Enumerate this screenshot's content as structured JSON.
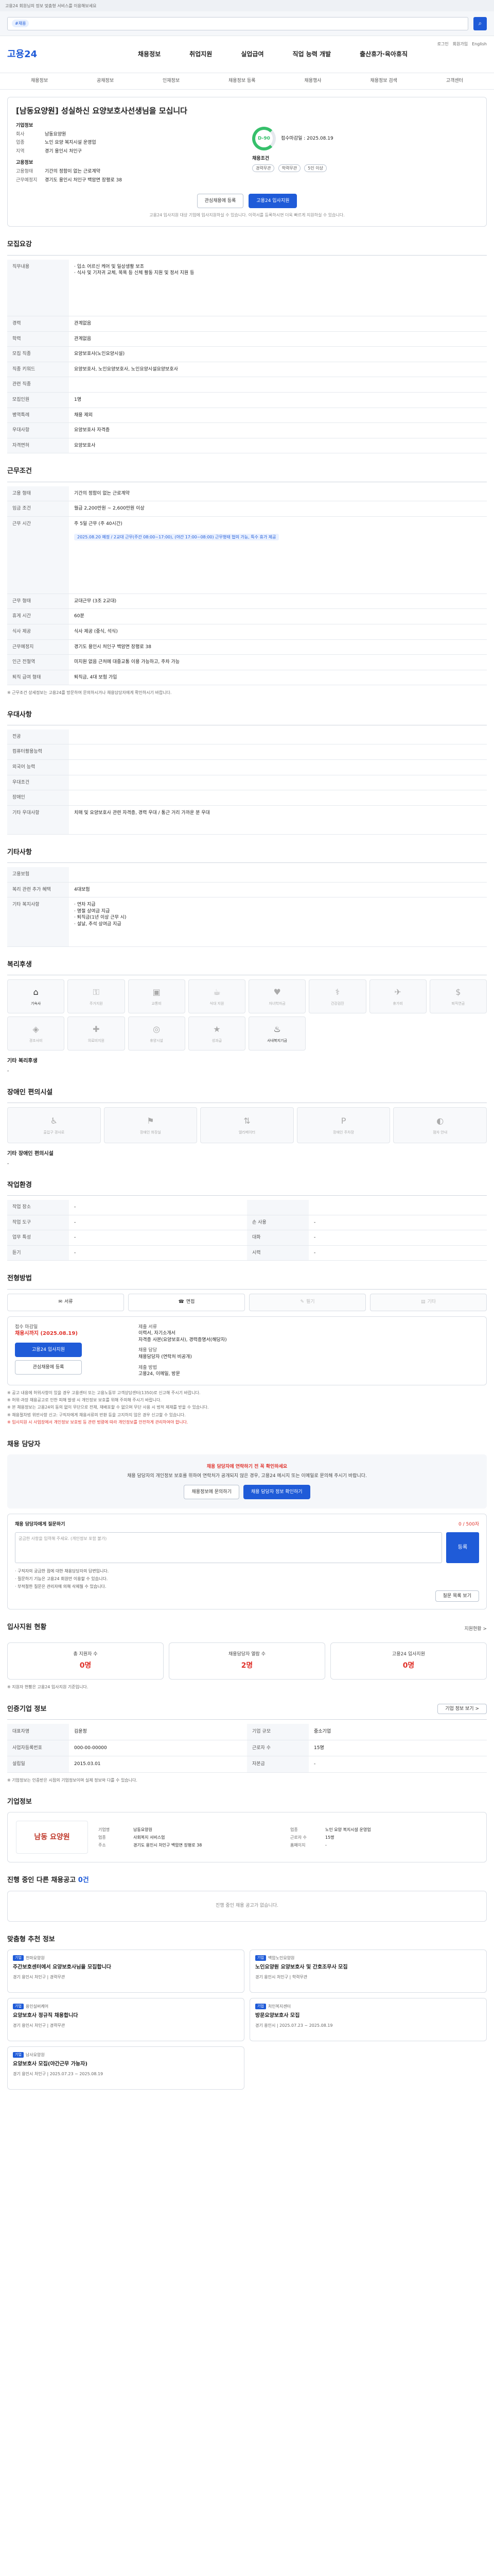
{
  "topnote": "고용24 회원님의 정보 맞춤형 서비스를 이용해보세요",
  "search": {
    "tag": "#채용",
    "placeholder": ""
  },
  "header": {
    "logo": "고용24",
    "gnb": [
      "채용정보",
      "취업지원",
      "실업급여",
      "직업 능력 개발",
      "출산휴가·육아휴직"
    ],
    "right": [
      "로그인",
      "회원가입",
      "English"
    ]
  },
  "subnav": [
    "채용정보",
    "공채정보",
    "인재정보",
    "채용정보 등록",
    "채용행사",
    "채용정보 검색",
    "고객센터"
  ],
  "title_card": {
    "title": "[남동요양원] 성실하신 요양보호사선생님을 모십니다",
    "company_label": "기업정보",
    "company_rows": [
      {
        "k": "회사",
        "v": "남동요양원"
      },
      {
        "k": "업종",
        "v": "노인 요양 복지시설 운영업"
      },
      {
        "k": "지역",
        "v": "경기 용인시 처인구"
      }
    ],
    "cond_label": "고용정보",
    "cond_rows": [
      {
        "k": "고용형태",
        "v": "기간의 정함이 없는 근로계약"
      },
      {
        "k": "근무예정지",
        "v": "경기도 용인시 처인구 백암면 장평로 38"
      }
    ],
    "dday": "D-90",
    "dday_text": "접수마감일 : 2025.08.19",
    "recruit_label": "채용조건",
    "chips": [
      "경력무관",
      "학력무관",
      "5인 이상"
    ],
    "btn_scrap": "관심채용에 등록",
    "btn_apply": "고용24 입사지원",
    "notice": "고용24 입사지원 대상 기업에 입사지원하실 수 있습니다. 이력서를 등록하시면 더욱 빠르게 지원하실 수 있습니다."
  },
  "recruit": {
    "section": "모집요강",
    "duty_label": "직무내용",
    "duty": "· 입소 어르신 케어 및 일상생활 보조\n· 식사 및 기저귀 교체, 목욕 등 신체 활동 지원 및 정서 지원 등",
    "rows": [
      {
        "k": "경력",
        "v": "관계없음"
      },
      {
        "k": "학력",
        "v": "관계없음"
      },
      {
        "k": "모집 직종",
        "v": "요양보호사(노인요양시설)"
      },
      {
        "k": "직종 키워드",
        "v": "요양보호사, 노인요양보호사, 노인요양시설요양보호사"
      },
      {
        "k": "관련 직종",
        "v": ""
      },
      {
        "k": "모집인원",
        "v": "1명"
      },
      {
        "k": "병역특례",
        "v": "채용 제외"
      },
      {
        "k": "우대사항",
        "v": "요양보호사 자격증"
      },
      {
        "k": "자격면허",
        "v": "요양보호사"
      }
    ]
  },
  "work": {
    "section": "근무조건",
    "rows": [
      {
        "k": "고용 형태",
        "v": "기간의 정함이 없는 근로계약"
      },
      {
        "k": "임금 조건",
        "v": "월급 2,200만원 ~ 2,600만원 이상"
      },
      {
        "k": "근무 시간",
        "v": "주 5일 근무 (주 40시간)"
      },
      {
        "k": "근무 형태",
        "v": "교대근무 (3조 2교대)"
      },
      {
        "k": "휴게 시간",
        "v": "60분"
      },
      {
        "k": "식사 제공",
        "v": "식사 제공 (중식, 석식)"
      },
      {
        "k": "근무예정지",
        "v": "경기도 용인시 처인구 백암면 장평로 38"
      },
      {
        "k": "인근 전철역",
        "v": "미지원 없음 근처에 대중교통 이용 가능하고, 주차 가능"
      },
      {
        "k": "퇴직 급여 형태",
        "v": "퇴직금, 4대 보험 가입"
      }
    ],
    "schedule": "2025.08.20 예정 / 2교대 근무(주간 08:00~17:00), (야간 17:00~08:00) 근무형태 협의 가능, 특수 휴가 제공",
    "footnote": "※ 근무조건 상세정보는 고용24를 방문하여 문의하시거나 채용담당자에게 확인하시기 바랍니다."
  },
  "welfare": {
    "section": "우대사항",
    "rows": [
      {
        "k": "전공",
        "v": ""
      },
      {
        "k": "컴퓨터활용능력",
        "v": ""
      },
      {
        "k": "외국어 능력",
        "v": ""
      },
      {
        "k": "우대조건",
        "v": ""
      },
      {
        "k": "장애인",
        "v": ""
      },
      {
        "k": "기타 우대사항",
        "v": "치매 및 요양보호사 관련 자격증, 경력 우대 / 통근 거리 가까운 분 우대"
      }
    ]
  },
  "etc": {
    "section": "기타사항",
    "rows": [
      {
        "k": "고용보험",
        "v": ""
      },
      {
        "k": "복리 관련 추가 혜택",
        "v": "4대보험"
      },
      {
        "k": "기타 복지사항",
        "v": "· 연차 지급\n· 명절 상여금 지급\n· 퇴직금(1년 이상 근무 시)\n· 설날, 추석 상여금 지급"
      }
    ]
  },
  "benefits": {
    "section": "복리후생",
    "items": [
      {
        "icon": "⌂",
        "label": "기숙사",
        "on": true
      },
      {
        "icon": "⚿",
        "label": "주거지원",
        "on": false
      },
      {
        "icon": "▣",
        "label": "교통비",
        "on": false
      },
      {
        "icon": "☕",
        "label": "식대 지원",
        "on": false
      },
      {
        "icon": "♥",
        "label": "자녀학자금",
        "on": false
      },
      {
        "icon": "⚕",
        "label": "건강검진",
        "on": false
      },
      {
        "icon": "✈",
        "label": "휴가비",
        "on": false
      },
      {
        "icon": "$",
        "label": "퇴직연금",
        "on": false
      },
      {
        "icon": "◈",
        "label": "경조사비",
        "on": false
      },
      {
        "icon": "✚",
        "label": "의료비지원",
        "on": false
      },
      {
        "icon": "◎",
        "label": "휴양시설",
        "on": false
      },
      {
        "icon": "★",
        "label": "성과급",
        "on": false
      },
      {
        "icon": "♨",
        "label": "사내복지기금",
        "on": true
      }
    ],
    "etc_label": "기타 복리후생",
    "etc_value": "-"
  },
  "disabled": {
    "section": "장애인 편의시설",
    "items": [
      {
        "icon": "♿",
        "label": "출입구 경사로"
      },
      {
        "icon": "⚑",
        "label": "장애인 화장실"
      },
      {
        "icon": "⇅",
        "label": "엘리베이터"
      },
      {
        "icon": "P",
        "label": "장애인 주차장"
      },
      {
        "icon": "◐",
        "label": "점자 안내"
      }
    ],
    "etc_label": "기타 장애인 편의시설",
    "etc_value": "-"
  },
  "env": {
    "section": "작업환경",
    "rows": [
      {
        "k": "작업 장소",
        "v": "-",
        "k2": "",
        "v2": ""
      },
      {
        "k": "작업 도구",
        "v": "-",
        "k2": "손 사용",
        "v2": "-"
      },
      {
        "k": "업무 특성",
        "v": "-",
        "k2": "대화",
        "v2": "-"
      },
      {
        "k": "듣기",
        "v": "-",
        "k2": "시력",
        "v2": "-"
      }
    ]
  },
  "apply": {
    "section": "전형방법",
    "methods": [
      {
        "icon": "✉",
        "label": "서류",
        "on": true
      },
      {
        "icon": "☎",
        "label": "면접",
        "on": true
      },
      {
        "icon": "✎",
        "label": "필기",
        "on": false
      },
      {
        "icon": "▤",
        "label": "기타",
        "on": false
      }
    ],
    "deadline_label": "접수 마감일",
    "deadline": "채용시까지 (2025.08.19)",
    "btn_apply": "고용24 입사지원",
    "btn_scrap": "관심채용에 등록",
    "docs_label": "제출 서류",
    "docs": "이력서, 자기소개서",
    "docs2": "자격증 사본(요양보호사), 경력증명서(해당자)",
    "contact_label": "채용 담당",
    "contact": "채용담당자 (연락처 비공개)",
    "etc_label": "제출 방법",
    "etc": "고용24, 이메일, 방문"
  },
  "notes": [
    "※ 공고 내용에 허위사항이 있을 경우 고용센터 또는 고용노동부 고객상담센터(1350)로 신고해 주시기 바랍니다.",
    "※ 허위·과장 채용공고로 인한 피해 발생 시 개인정보 보호를 위해 주의해 주시기 바랍니다.",
    "※ 본 채용정보는 고용24의 동의 없이 무단으로 전재, 재배포할 수 없으며 무단 사용 시 법적 제재를 받을 수 있습니다.",
    "※ 채용절차법 위반사항 신고: 구직자에게 채용서류의 반환 등을 고지하지 않은 경우 신고할 수 있습니다."
  ],
  "notes_red": "※ 입사지원 시 사업장에서 개인정보 보호법 등 관련 법령에 따라 개인정보를 안전하게 관리하여야 합니다.",
  "contact": {
    "section": "채용 담당자",
    "title": "채용 담당자에 연락하기 전 꼭 확인하세요",
    "text": "채용 담당자의 개인정보 보호를 위하여 연락처가 공개되지 않은 경우, 고용24 메시지 또는 이메일로 문의해 주시기 바랍니다.",
    "btn1": "채용정보에 문의하기",
    "btn2": "채용 담당자 정보 확인하기"
  },
  "qna": {
    "label": "채용 담당자에게 질문하기",
    "count": "0 / 500자",
    "placeholder": "궁금한 사항을 입력해 주세요. (개인정보 포함 불가)",
    "btn": "등록",
    "checks": [
      "· 구직자의 궁금한 점에 대한 채용담당자의 답변입니다.",
      "· 질문하기 기능은 고용24 회원만 이용할 수 있습니다.",
      "· 부적절한 질문은 관리자에 의해 삭제될 수 있습니다."
    ],
    "btn_more": "질문 목록 보기"
  },
  "status": {
    "section": "입사지원 현황",
    "link": "지원현황 >",
    "items": [
      {
        "label": "총 지원자 수",
        "value": "0명"
      },
      {
        "label": "채용담당자 열람 수",
        "value": "2명"
      },
      {
        "label": "고용24 입사지원",
        "value": "0명"
      }
    ],
    "note": "※ 지원자 현황은 고용24 입사지원 기준입니다."
  },
  "company": {
    "section": "인증기업 정보",
    "link": "기업 정보 보기 >",
    "rows": [
      {
        "k": "대표자명",
        "v": "김윤정",
        "k2": "기업 규모",
        "v2": "중소기업"
      },
      {
        "k": "사업자등록번호",
        "v": "000-00-00000",
        "k2": "근로자 수",
        "v2": "15명"
      },
      {
        "k": "설립일",
        "v": "2015.03.01",
        "k2": "자본금",
        "v2": "-"
      }
    ],
    "note": "※ 기업정보는 인증받은 시점의 기업정보이며 실제 정보와 다를 수 있습니다."
  },
  "biz": {
    "section": "기업정보",
    "logo": "남동 요양원",
    "rows": [
      {
        "k": "기업명",
        "v": "남동요양원",
        "k2": "업종",
        "v2": "노인 요양 복지시설 운영업"
      },
      {
        "k": "업종",
        "v": "사회복지 서비스업",
        "k2": "근로자 수",
        "v2": "15명"
      },
      {
        "k": "주소",
        "v": "경기도 용인시 처인구 백암면 장평로 38",
        "k2": "홈페이지",
        "v2": "-"
      }
    ]
  },
  "other_jobs": {
    "section": "진행 중인 다른 채용공고",
    "count": "0건",
    "empty": "진행 중인 채용 공고가 없습니다."
  },
  "recommend": {
    "section": "맞춤형 추천 정보",
    "items": [
      {
        "company": "천마요양원",
        "title": "주간보호센터에서 요양보호사님을 모집합니다",
        "meta": "경기 용인시 처인구 | 경력무관"
      },
      {
        "company": "백암노인요양원",
        "title": "노인요양원 요양보호사 및 간호조무사 모집",
        "meta": "경기 용인시 처인구 | 학력무관"
      },
      {
        "company": "용인실버케어",
        "title": "요양보호사 정규직 채용합니다",
        "meta": "경기 용인시 처인구 | 경력무관"
      },
      {
        "company": "처인복지센터",
        "title": "방문요양보호사 모집",
        "meta": "경기 용인시 | 2025.07.23 ~ 2025.08.19"
      },
      {
        "company": "남사요양원",
        "title": "요양보호사 모집(야간근무 가능자)",
        "meta": "경기 용인시 처인구 | 2025.07.23 ~ 2025.08.19"
      }
    ]
  }
}
